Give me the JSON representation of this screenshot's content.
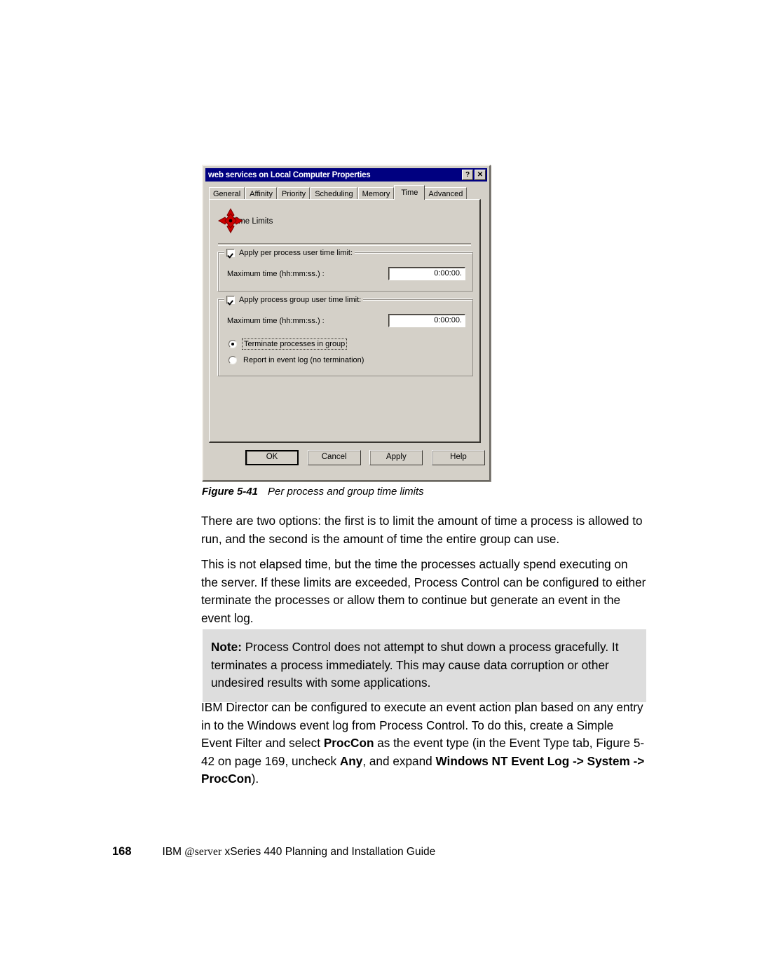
{
  "dialog": {
    "title": "web services on Local Computer Properties",
    "title_buttons": [
      {
        "name": "help",
        "glyph": "?"
      },
      {
        "name": "close",
        "glyph": "✕"
      }
    ],
    "tabs": [
      {
        "label": "General",
        "active": false
      },
      {
        "label": "Affinity",
        "active": false
      },
      {
        "label": "Priority",
        "active": false
      },
      {
        "label": "Scheduling",
        "active": false
      },
      {
        "label": "Memory",
        "active": false
      },
      {
        "label": "Time",
        "active": true
      },
      {
        "label": "Advanced",
        "active": false
      }
    ],
    "header": {
      "icon": "red-four-way-arrow-icon",
      "label": "Time Limits"
    },
    "group_process": {
      "checkbox_label": "Apply per process user time limit:",
      "checked": true,
      "field_label": "Maximum time (hh:mm:ss.) :",
      "field_value": "0:00:00."
    },
    "group_group": {
      "checkbox_label": "Apply process group user time limit:",
      "checked": true,
      "field_label": "Maximum time (hh:mm:ss.) :",
      "field_value": "0:00:00.",
      "radios": [
        {
          "label": "Terminate processes in group",
          "selected": true,
          "focused": true
        },
        {
          "label": "Report in event log (no termination)",
          "selected": false,
          "focused": false
        }
      ]
    },
    "buttons": [
      {
        "label": "OK",
        "default": true
      },
      {
        "label": "Cancel",
        "default": false
      },
      {
        "label": "Apply",
        "default": false
      },
      {
        "label": "Help",
        "default": false
      }
    ],
    "colors": {
      "titlebar": "#000080",
      "face": "#d4d0c8",
      "icon_red": "#cc0000"
    }
  },
  "figure": {
    "number": "Figure 5-41",
    "caption": "Per process and group time limits"
  },
  "body": {
    "paragraph_1": "There are two options: the first is to limit the amount of time a process is allowed to run, and the second is the amount of time the entire group can use.",
    "paragraph_2": "This is not elapsed time, but the time the processes actually spend executing on the server. If these limits are exceeded, Process Control can be configured to either terminate the processes or allow them to continue but generate an event in the event log.",
    "note": {
      "label": "Note:",
      "text": "Process Control does not attempt to shut down a process gracefully. It terminates a process immediately. This may cause data corruption or other undesired results with some applications.",
      "background": "#dddddd"
    },
    "paragraph_3": {
      "seg_1": "IBM Director can be configured to execute an event action plan based on any entry in to the Windows event log from Process Control. To do this, create a Simple Event Filter and select ",
      "bold_1": "ProcCon",
      "seg_2": " as the event type (in the Event Type tab, Figure 5-42 on page 169, uncheck ",
      "bold_2": "Any",
      "seg_3": ", and expand ",
      "bold_3": "Windows NT Event Log -> System -> ProcCon",
      "seg_4": ")."
    }
  },
  "footer": {
    "page_number": "168",
    "prefix": "IBM ",
    "eserver": "@server",
    "suffix": " xSeries 440 Planning and Installation Guide"
  }
}
